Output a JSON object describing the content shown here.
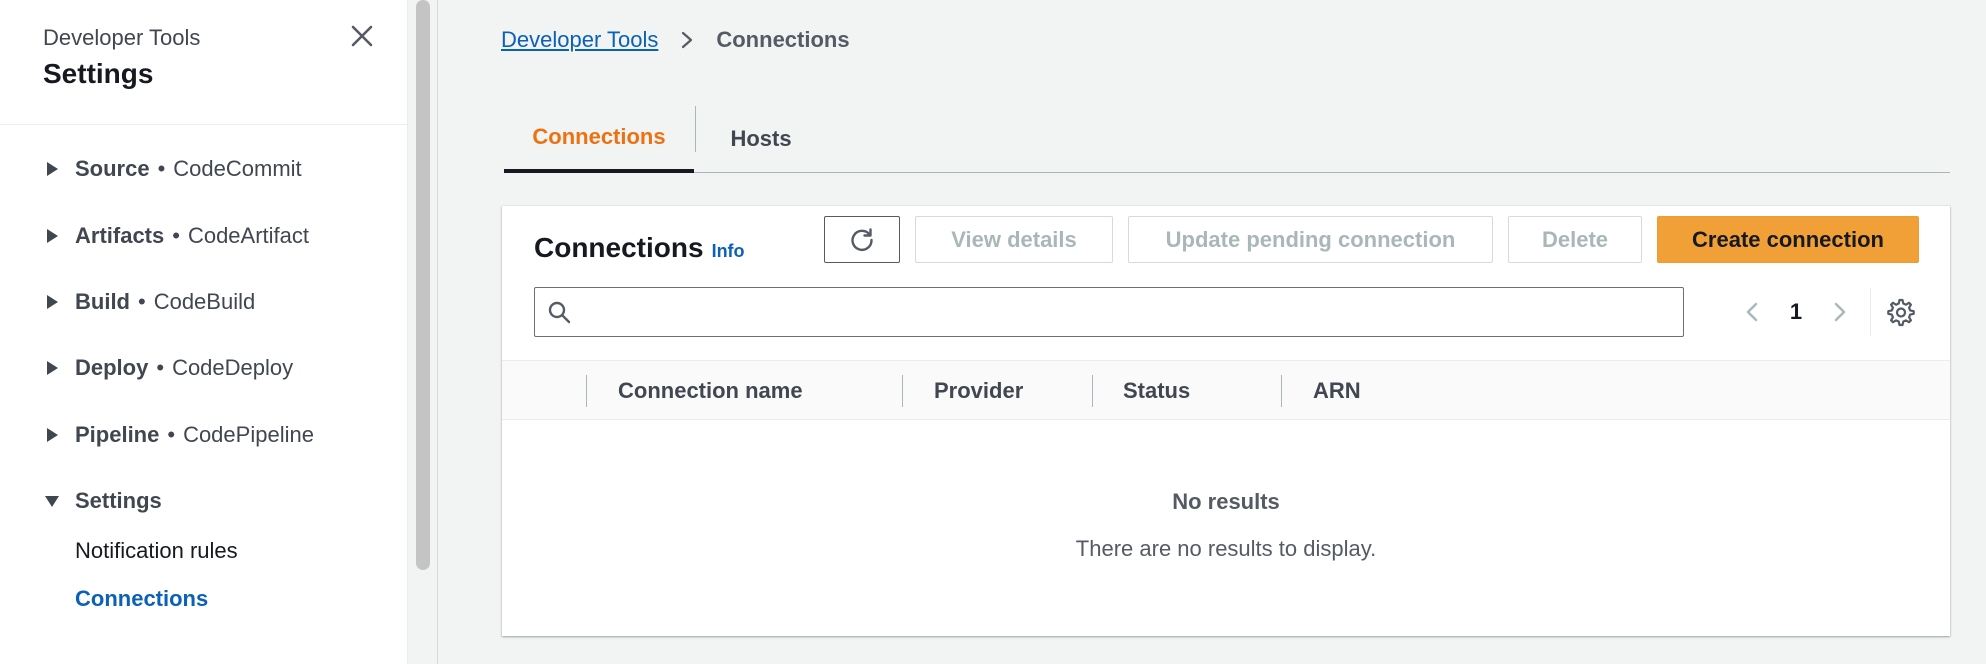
{
  "sidebar": {
    "service_name": "Developer Tools",
    "title": "Settings",
    "sections": [
      {
        "label": "Source",
        "service": "CodeCommit",
        "expanded": false
      },
      {
        "label": "Artifacts",
        "service": "CodeArtifact",
        "expanded": false
      },
      {
        "label": "Build",
        "service": "CodeBuild",
        "expanded": false
      },
      {
        "label": "Deploy",
        "service": "CodeDeploy",
        "expanded": false
      },
      {
        "label": "Pipeline",
        "service": "CodePipeline",
        "expanded": false
      },
      {
        "label": "Settings",
        "service": "",
        "expanded": true
      }
    ],
    "settings_items": [
      {
        "label": "Notification rules",
        "active": false
      },
      {
        "label": "Connections",
        "active": true
      }
    ]
  },
  "breadcrumb": {
    "root": "Developer Tools",
    "current": "Connections"
  },
  "tabs": [
    {
      "label": "Connections",
      "active": true
    },
    {
      "label": "Hosts",
      "active": false
    }
  ],
  "panel": {
    "title": "Connections",
    "info_label": "Info",
    "buttons": {
      "view_details": "View details",
      "update_pending": "Update pending connection",
      "delete": "Delete",
      "create": "Create connection"
    },
    "search": {
      "value": "",
      "placeholder": ""
    },
    "pagination": {
      "current_page": "1"
    },
    "columns": [
      "Connection name",
      "Provider",
      "Status",
      "ARN"
    ],
    "empty_title": "No results",
    "empty_description": "There are no results to display."
  },
  "colors": {
    "accent_orange": "#ec7211",
    "primary_button": "#f0a036",
    "link_blue": "#0b61b5"
  }
}
